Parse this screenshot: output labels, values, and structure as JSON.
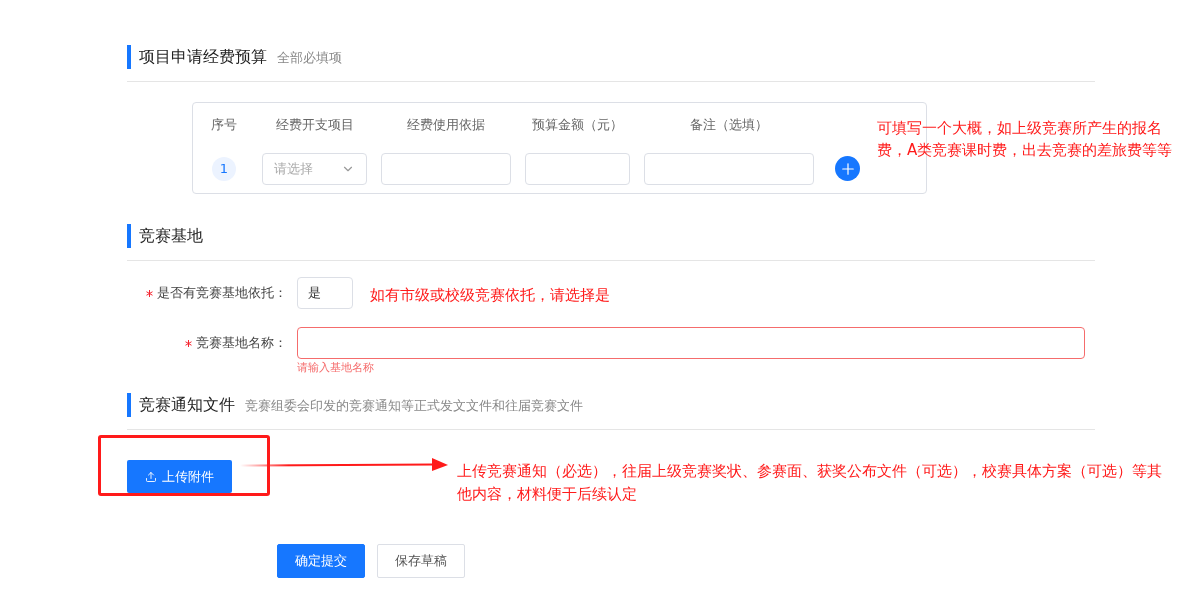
{
  "budget": {
    "title": "项目申请经费预算",
    "subtitle": "全部必填项",
    "columns": [
      "序号",
      "经费开支项目",
      "经费使用依据",
      "预算金额（元）",
      "备注（选填）"
    ],
    "rows": [
      {
        "index": "1",
        "item_placeholder": "请选择"
      }
    ]
  },
  "base": {
    "title": "竞赛基地",
    "fields": [
      {
        "kind": "select",
        "label": "是否有竞赛基地依托：",
        "required": true,
        "value": "是",
        "invalid": false
      },
      {
        "kind": "input",
        "label": "竞赛基地名称：",
        "required": true,
        "invalid": true,
        "error": "请输入基地名称"
      }
    ]
  },
  "notice": {
    "title": "竞赛通知文件",
    "subtitle": "竞赛组委会印发的竞赛通知等正式发文文件和往届竞赛文件",
    "upload_button": "上传附件"
  },
  "actions": [
    {
      "label": "确定提交",
      "kind": "primary"
    },
    {
      "label": "保存草稿",
      "kind": "default"
    }
  ],
  "annotations": [
    "可填写一个大概，如上级竞赛所产生的报名费，A类竞赛课时费，出去竞赛的差旅费等等",
    "如有市级或校级竞赛依托，请选择是",
    "上传竞赛通知（必选），往届上级竞赛奖状、参赛面、获奖公布文件（可选），校赛具体方案（可选）等其他内容，材料便于后续认定"
  ]
}
